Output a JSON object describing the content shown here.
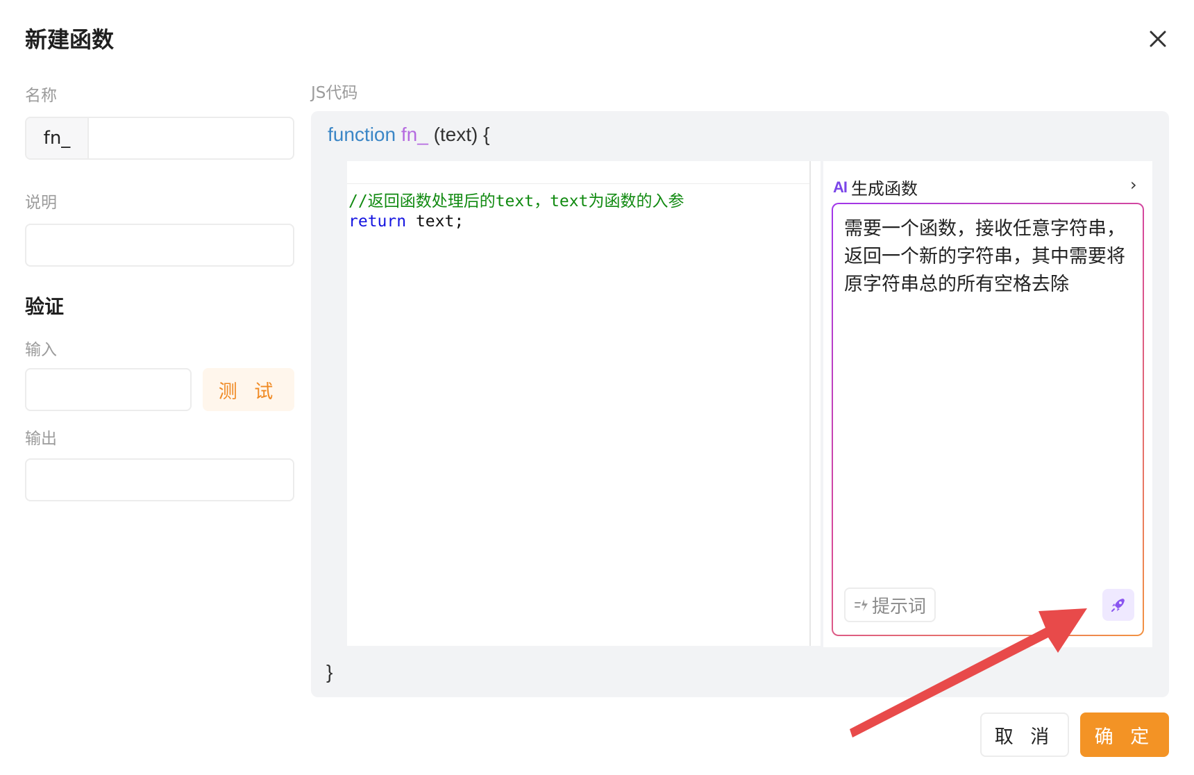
{
  "dialog": {
    "title": "新建函数"
  },
  "form": {
    "name_label": "名称",
    "name_prefix": "fn_",
    "name_value": "",
    "desc_label": "说明",
    "desc_value": "",
    "verify_title": "验证",
    "input_label": "输入",
    "input_value": "",
    "test_button": "测 试",
    "output_label": "输出",
    "output_value": ""
  },
  "code": {
    "label": "JS代码",
    "signature_keyword": "function",
    "signature_name": "fn_",
    "signature_params": "(text) {",
    "comment_line": "//返回函数处理后的text，text为函数的入参",
    "return_keyword": "return",
    "return_rest": " text;",
    "closing_brace": "}"
  },
  "ai": {
    "logo": "AI",
    "title": "生成函数",
    "chevron": "›",
    "prompt": "需要一个函数，接收任意字符串，返回一个新的字符串，其中需要将原字符串总的所有空格去除",
    "hint_button": "提示词",
    "send_icon": "rocket-icon"
  },
  "footer": {
    "cancel": "取 消",
    "confirm": "确 定"
  },
  "colors": {
    "accent": "#f39325",
    "ai_purple": "#7a45e8",
    "annotation_arrow": "#e84a4a"
  }
}
